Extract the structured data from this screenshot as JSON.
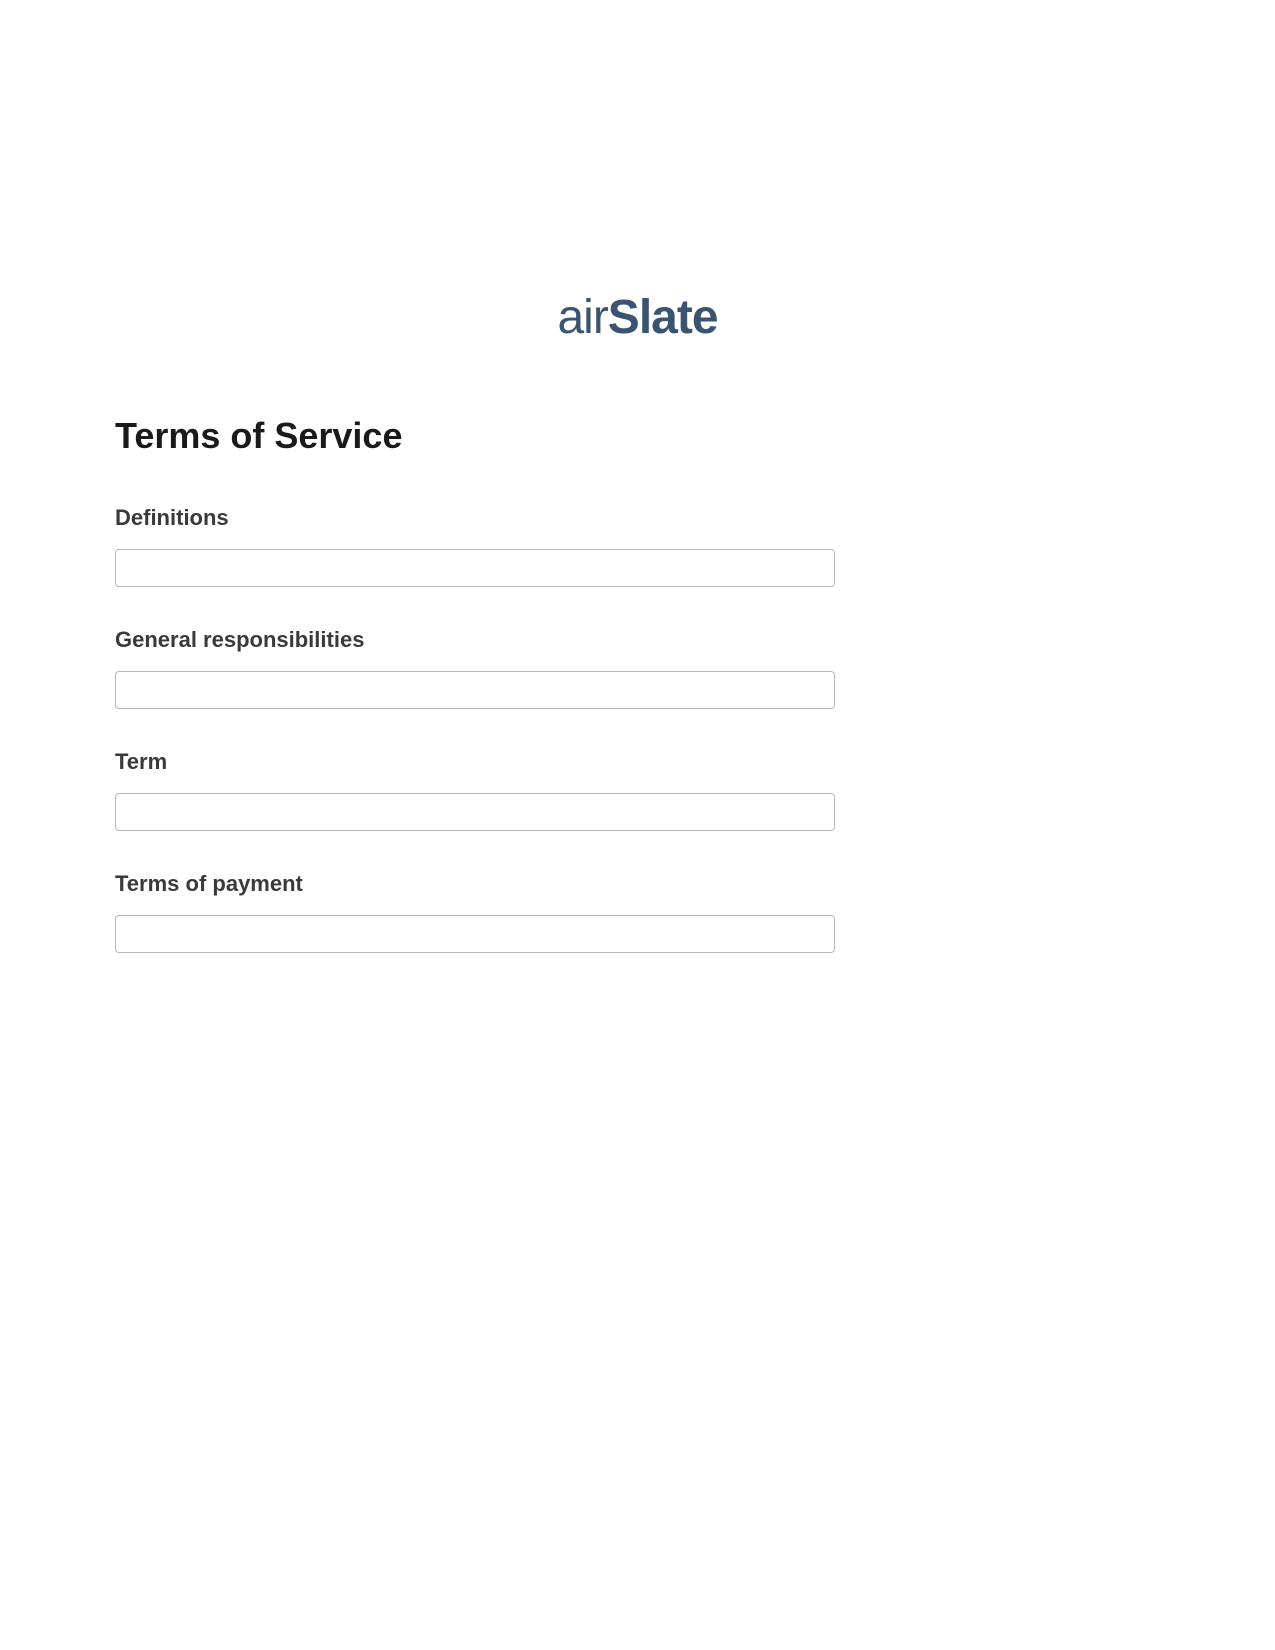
{
  "logo": {
    "part1": "air",
    "part2": "Slate"
  },
  "title": "Terms of Service",
  "fields": [
    {
      "label": "Definitions",
      "value": ""
    },
    {
      "label": "General responsibilities",
      "value": ""
    },
    {
      "label": "Term",
      "value": ""
    },
    {
      "label": "Terms of payment",
      "value": ""
    }
  ]
}
